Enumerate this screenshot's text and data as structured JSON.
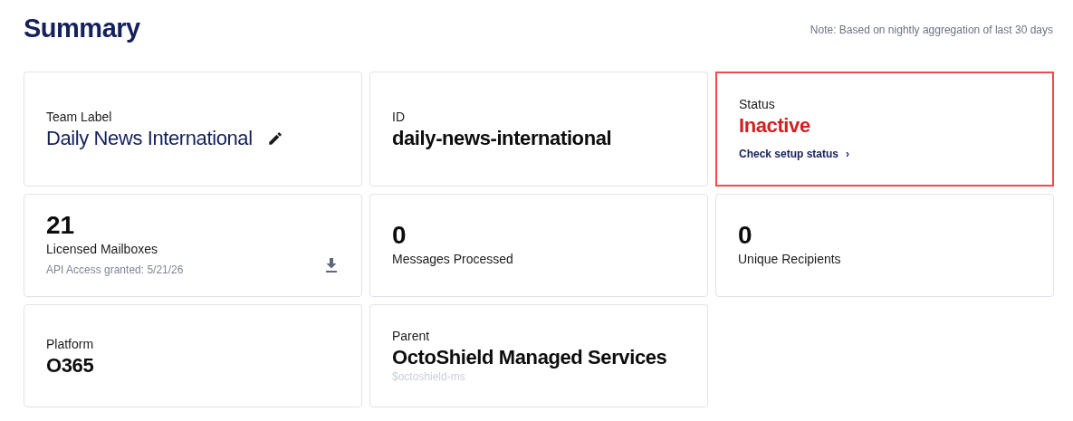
{
  "title": "Summary",
  "note": "Note: Based on nightly aggregation of last 30 days",
  "cards": [
    {
      "kind": "field",
      "label": "Team Label",
      "value": "Daily News International",
      "editable": true
    },
    {
      "kind": "field",
      "label": "ID",
      "value": "daily-news-international"
    },
    {
      "kind": "field",
      "label": "Status",
      "value": "Inactive",
      "alert": true,
      "link": "Check setup status",
      "link_icon": "›"
    },
    {
      "kind": "metric",
      "value": "21",
      "label": "Licensed Mailboxes",
      "note": "API Access granted: 5/21/26",
      "download": true
    },
    {
      "kind": "metric",
      "value": "0",
      "label": "Messages Processed"
    },
    {
      "kind": "metric",
      "value": "0",
      "label": "Unique Recipients"
    },
    {
      "kind": "field",
      "label": "Platform",
      "value": "O365"
    },
    {
      "kind": "field",
      "label": "Parent",
      "value": "OctoShield Managed Services",
      "note": "$octoshield-ms"
    }
  ]
}
